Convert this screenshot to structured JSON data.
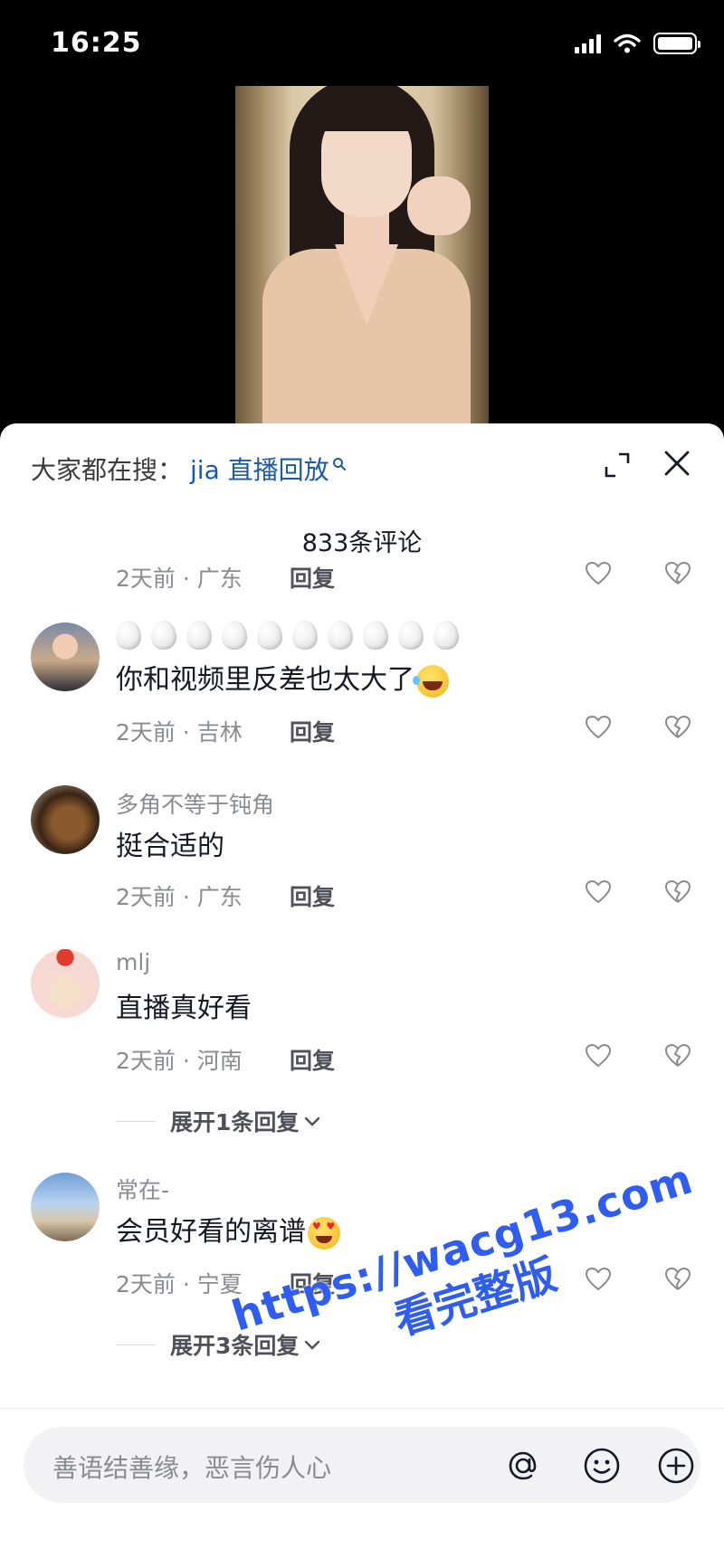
{
  "status_bar": {
    "time": "16:25"
  },
  "header": {
    "search_prefix": "大家都在搜：",
    "search_term": "jia 直播回放",
    "comment_count": "833条评论"
  },
  "comments": [
    {
      "name": "",
      "text": "",
      "meta": "2天前 · 广东",
      "reply_label": "回复"
    },
    {
      "name": "",
      "text": "你和视频里反差也太大了",
      "meta": "2天前 · 吉林",
      "reply_label": "回复",
      "emoji": "rolling-on-floor-laughing"
    },
    {
      "name": "多角不等于钝角",
      "text": "挺合适的",
      "meta": "2天前 · 广东",
      "reply_label": "回复"
    },
    {
      "name": "mlj",
      "text": "直播真好看",
      "meta": "2天前 · 河南",
      "reply_label": "回复",
      "expand_label": "展开1条回复"
    },
    {
      "name": "常在-",
      "text": "会员好看的离谱",
      "meta": "2天前 · 宁夏",
      "reply_label": "回复",
      "emoji": "heart-eyes",
      "expand_label": "展开3条回复"
    }
  ],
  "input": {
    "placeholder": "善语结善缘，恶言伤人心"
  },
  "watermark": {
    "url": "https://wacg13.com",
    "text": "看完整版"
  },
  "colors": {
    "link_blue": "#1d5aa6",
    "watermark_blue": "#2f5df0",
    "muted_gray": "#8a8b91"
  }
}
